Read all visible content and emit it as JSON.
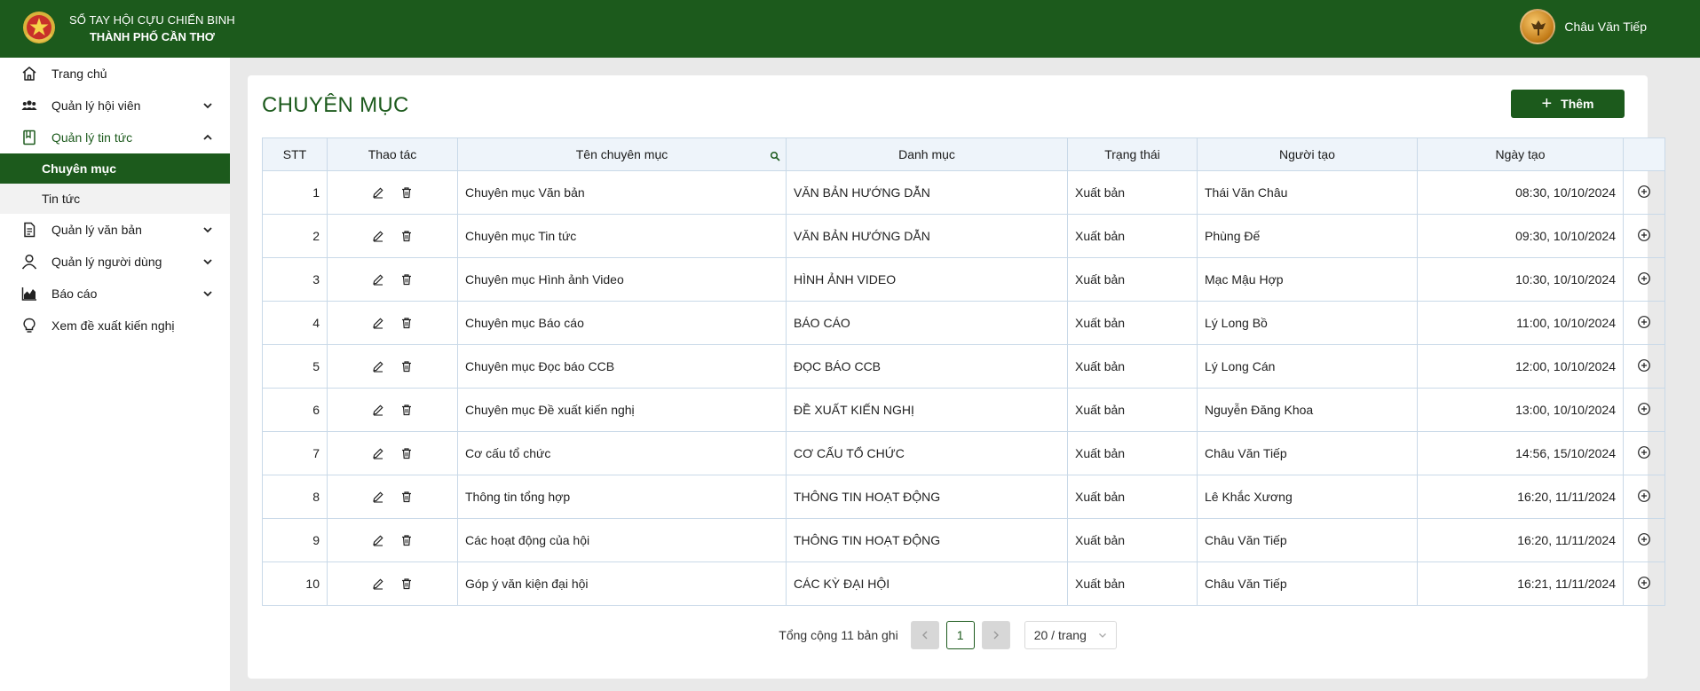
{
  "header": {
    "brand_line1": "SỔ TAY HỘI CỰU CHIẾN BINH",
    "brand_line2": "THÀNH PHỐ CẦN THƠ",
    "user_name": "Châu Văn Tiếp"
  },
  "sidebar": {
    "items": [
      {
        "label": "Trang chủ",
        "icon": "home-icon"
      },
      {
        "label": "Quản lý hội viên",
        "icon": "users-icon",
        "chevron": "down"
      },
      {
        "label": "Quản lý tin tức",
        "icon": "book-icon",
        "chevron": "up",
        "open": true,
        "children": [
          {
            "label": "Chuyên mục",
            "active": true
          },
          {
            "label": "Tin tức"
          }
        ]
      },
      {
        "label": "Quản lý văn bản",
        "icon": "document-icon",
        "chevron": "down"
      },
      {
        "label": "Quản lý người dùng",
        "icon": "user-icon",
        "chevron": "down"
      },
      {
        "label": "Báo cáo",
        "icon": "chart-icon",
        "chevron": "down"
      },
      {
        "label": "Xem đề xuất kiến nghị",
        "icon": "lightbulb-icon"
      }
    ]
  },
  "main": {
    "title": "CHUYÊN MỤC",
    "add_label": "Thêm",
    "table": {
      "headers": [
        "STT",
        "Thao tác",
        "Tên chuyên mục",
        "Danh mục",
        "Trạng thái",
        "Người tạo",
        "Ngày tạo",
        ""
      ],
      "rows": [
        [
          "1",
          "Chuyên mục Văn bản",
          "VĂN BẢN HƯỚNG DẪN",
          "Xuất bản",
          "Thái Văn Châu",
          "08:30, 10/10/2024"
        ],
        [
          "2",
          "Chuyên mục Tin tức",
          "VĂN BẢN HƯỚNG DẪN",
          "Xuất bản",
          "Phùng Đế",
          "09:30, 10/10/2024"
        ],
        [
          "3",
          "Chuyên mục Hình ảnh Video",
          "HÌNH ẢNH VIDEO",
          "Xuất bản",
          "Mạc Mậu Hợp",
          "10:30, 10/10/2024"
        ],
        [
          "4",
          "Chuyên mục Báo cáo",
          "BÁO CÁO",
          "Xuất bản",
          "Lý Long Bồ",
          "11:00, 10/10/2024"
        ],
        [
          "5",
          "Chuyên mục Đọc báo CCB",
          "ĐỌC BÁO CCB",
          "Xuất bản",
          "Lý Long Cán",
          "12:00, 10/10/2024"
        ],
        [
          "6",
          "Chuyên mục Đề xuất kiến nghị",
          "ĐỀ XUẤT KIẾN NGHỊ",
          "Xuất bản",
          "Nguyễn Đăng Khoa",
          "13:00, 10/10/2024"
        ],
        [
          "7",
          "Cơ cấu tổ chức",
          "CƠ CẤU TỔ CHỨC",
          "Xuất bản",
          "Châu Văn Tiếp",
          "14:56, 15/10/2024"
        ],
        [
          "8",
          "Thông tin tổng hợp",
          "THÔNG TIN HOẠT ĐỘNG",
          "Xuất bản",
          "Lê Khắc Xương",
          "16:20, 11/11/2024"
        ],
        [
          "9",
          "Các hoạt động của hội",
          "THÔNG TIN HOẠT ĐỘNG",
          "Xuất bản",
          "Châu Văn Tiếp",
          "16:20, 11/11/2024"
        ],
        [
          "10",
          "Góp ý văn kiện đại hội",
          "CÁC KỲ ĐẠI HỘI",
          "Xuất bản",
          "Châu Văn Tiếp",
          "16:21, 11/11/2024"
        ]
      ]
    },
    "pagination": {
      "total_text": "Tổng cộng 11 bản ghi",
      "current_page": "1",
      "page_size": "20 / trang"
    }
  },
  "colors": {
    "primary": "#1c5a1c",
    "table_header_bg": "#eef4fa",
    "border": "#c9d9e8"
  }
}
